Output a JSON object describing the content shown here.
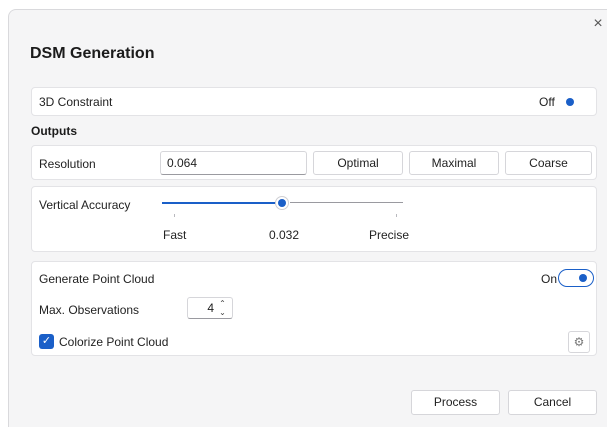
{
  "dialog": {
    "title": "DSM Generation",
    "close_glyph": "×"
  },
  "constraint": {
    "label": "3D Constraint",
    "toggle_label": "Off",
    "value": false
  },
  "outputs": {
    "section_label": "Outputs",
    "resolution_label": "Resolution",
    "resolution_value": "0.064",
    "buttons": [
      "Optimal",
      "Maximal",
      "Coarse"
    ]
  },
  "accuracy": {
    "label": "Vertical Accuracy",
    "min_label": "Fast",
    "value_label": "0.032",
    "max_label": "Precise",
    "level": 0.5
  },
  "point_cloud": {
    "label": "Generate Point Cloud",
    "toggle_label": "On",
    "value": true,
    "max_obs_label": "Max. Observations",
    "max_obs_value": "4",
    "colorize_label": "Colorize Point Cloud",
    "colorize_checked": true,
    "settings_icon": "gear-icon"
  },
  "footer": {
    "process_label": "Process",
    "cancel_label": "Cancel"
  },
  "colors": {
    "accent": "#1a5fc8",
    "background": "#f5f5f6"
  }
}
